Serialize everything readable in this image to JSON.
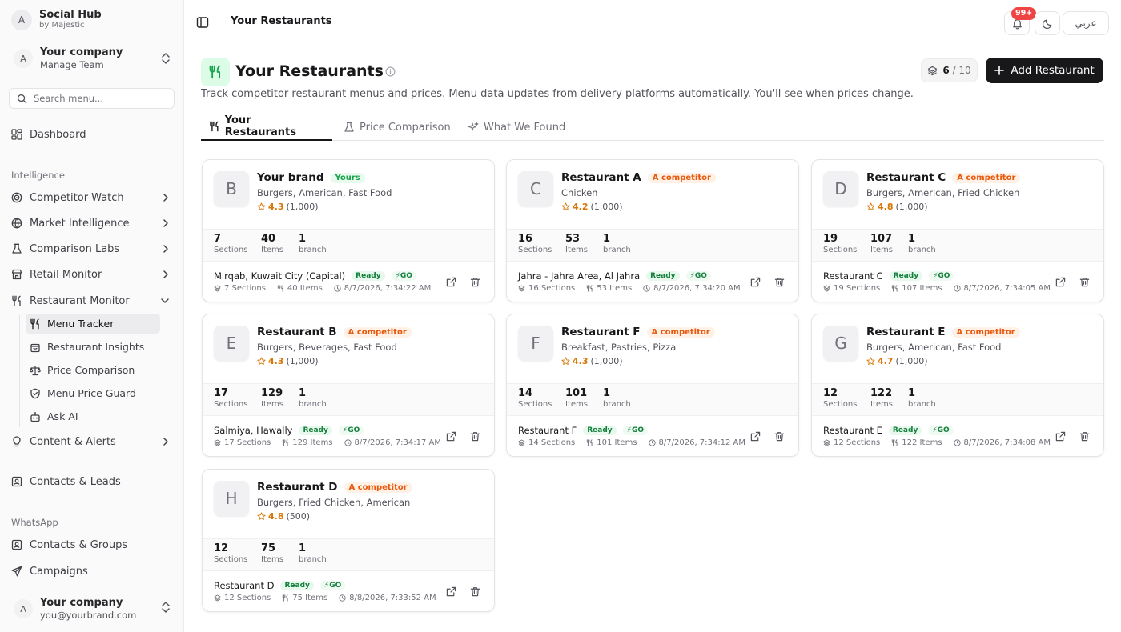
{
  "sidebar": {
    "brand_avatar": "A",
    "brand_title": "Social Hub",
    "brand_sub": "by Majestic",
    "company_avatar": "A",
    "company_name": "Your company",
    "company_sub": "Manage Team",
    "search_placeholder": "Search menu...",
    "dashboard": "Dashboard",
    "section_intelligence": "Intelligence",
    "competitor_watch": "Competitor Watch",
    "market_intelligence": "Market Intelligence",
    "comparison_labs": "Comparison Labs",
    "retail_monitor": "Retail Monitor",
    "restaurant_monitor": "Restaurant Monitor",
    "sub_items": [
      "Menu Tracker",
      "Restaurant Insights",
      "Price Comparison",
      "Menu Price Guard",
      "Ask AI"
    ],
    "content_alerts": "Content & Alerts",
    "contacts_leads": "Contacts & Leads",
    "section_whatsapp": "WhatsApp",
    "contacts_groups": "Contacts & Groups",
    "campaigns": "Campaigns",
    "user_avatar": "A",
    "user_name": "Your company",
    "user_email": "you@yourbrand.com"
  },
  "header": {
    "title": "Your Restaurants",
    "notif_badge": "99+",
    "lang_label": "عربي"
  },
  "page": {
    "title": "Your Restaurants",
    "description": "Track competitor restaurant menus and prices. Menu data updates from delivery platforms automatically. You'll see when prices change.",
    "count_used": "6",
    "count_sep": "/ 10",
    "add_button": "Add Restaurant",
    "tabs": [
      "Your Restaurants",
      "Price Comparison",
      "What We Found"
    ]
  },
  "labels": {
    "sections": "Sections",
    "items": "Items",
    "branch": "branch",
    "ready": "Ready",
    "go": "GO"
  },
  "colors": {
    "accent_green": "#16a34a",
    "competitor_orange": "#ea580c",
    "star": "#d97706",
    "primary_button": "#18181b",
    "notification_red": "#ef4444"
  },
  "restaurants": [
    {
      "letter": "B",
      "name": "Your brand",
      "badge": "Yours",
      "badge_type": "yours",
      "cuisine": "Burgers, American, Fast Food",
      "rating": "4.3",
      "reviews": "(1,000)",
      "sections": "7",
      "items": "40",
      "branches": "1",
      "location": "Mirqab, Kuwait City (Capital)",
      "meta_sections": "7 Sections",
      "meta_items": "40 Items",
      "updated": "8/7/2026, 7:34:22 AM"
    },
    {
      "letter": "C",
      "name": "Restaurant A",
      "badge": "A competitor",
      "badge_type": "competitor",
      "cuisine": "Chicken",
      "rating": "4.2",
      "reviews": "(1,000)",
      "sections": "16",
      "items": "53",
      "branches": "1",
      "location": "Jahra - Jahra Area, Al Jahra",
      "meta_sections": "16 Sections",
      "meta_items": "53 Items",
      "updated": "8/7/2026, 7:34:20 AM"
    },
    {
      "letter": "D",
      "name": "Restaurant C",
      "badge": "A competitor",
      "badge_type": "competitor",
      "cuisine": "Burgers, American, Fried Chicken",
      "rating": "4.8",
      "reviews": "(1,000)",
      "sections": "19",
      "items": "107",
      "branches": "1",
      "location": "Restaurant C",
      "meta_sections": "19 Sections",
      "meta_items": "107 Items",
      "updated": "8/7/2026, 7:34:05 AM"
    },
    {
      "letter": "E",
      "name": "Restaurant B",
      "badge": "A competitor",
      "badge_type": "competitor",
      "cuisine": "Burgers, Beverages, Fast Food",
      "rating": "4.3",
      "reviews": "(1,000)",
      "sections": "17",
      "items": "129",
      "branches": "1",
      "location": "Salmiya, Hawally",
      "meta_sections": "17 Sections",
      "meta_items": "129 Items",
      "updated": "8/7/2026, 7:34:17 AM"
    },
    {
      "letter": "F",
      "name": "Restaurant F",
      "badge": "A competitor",
      "badge_type": "competitor",
      "cuisine": "Breakfast, Pastries, Pizza",
      "rating": "4.3",
      "reviews": "(1,000)",
      "sections": "14",
      "items": "101",
      "branches": "1",
      "location": "Restaurant F",
      "meta_sections": "14 Sections",
      "meta_items": "101 Items",
      "updated": "8/7/2026, 7:34:12 AM"
    },
    {
      "letter": "G",
      "name": "Restaurant E",
      "badge": "A competitor",
      "badge_type": "competitor",
      "cuisine": "Burgers, American, Fast Food",
      "rating": "4.7",
      "reviews": "(1,000)",
      "sections": "12",
      "items": "122",
      "branches": "1",
      "location": "Restaurant E",
      "meta_sections": "12 Sections",
      "meta_items": "122 Items",
      "updated": "8/7/2026, 7:34:08 AM"
    },
    {
      "letter": "H",
      "name": "Restaurant D",
      "badge": "A competitor",
      "badge_type": "competitor",
      "cuisine": "Burgers, Fried Chicken, American",
      "rating": "4.8",
      "reviews": "(500)",
      "sections": "12",
      "items": "75",
      "branches": "1",
      "location": "Restaurant D",
      "meta_sections": "12 Sections",
      "meta_items": "75 Items",
      "updated": "8/8/2026, 7:33:52 AM"
    }
  ]
}
